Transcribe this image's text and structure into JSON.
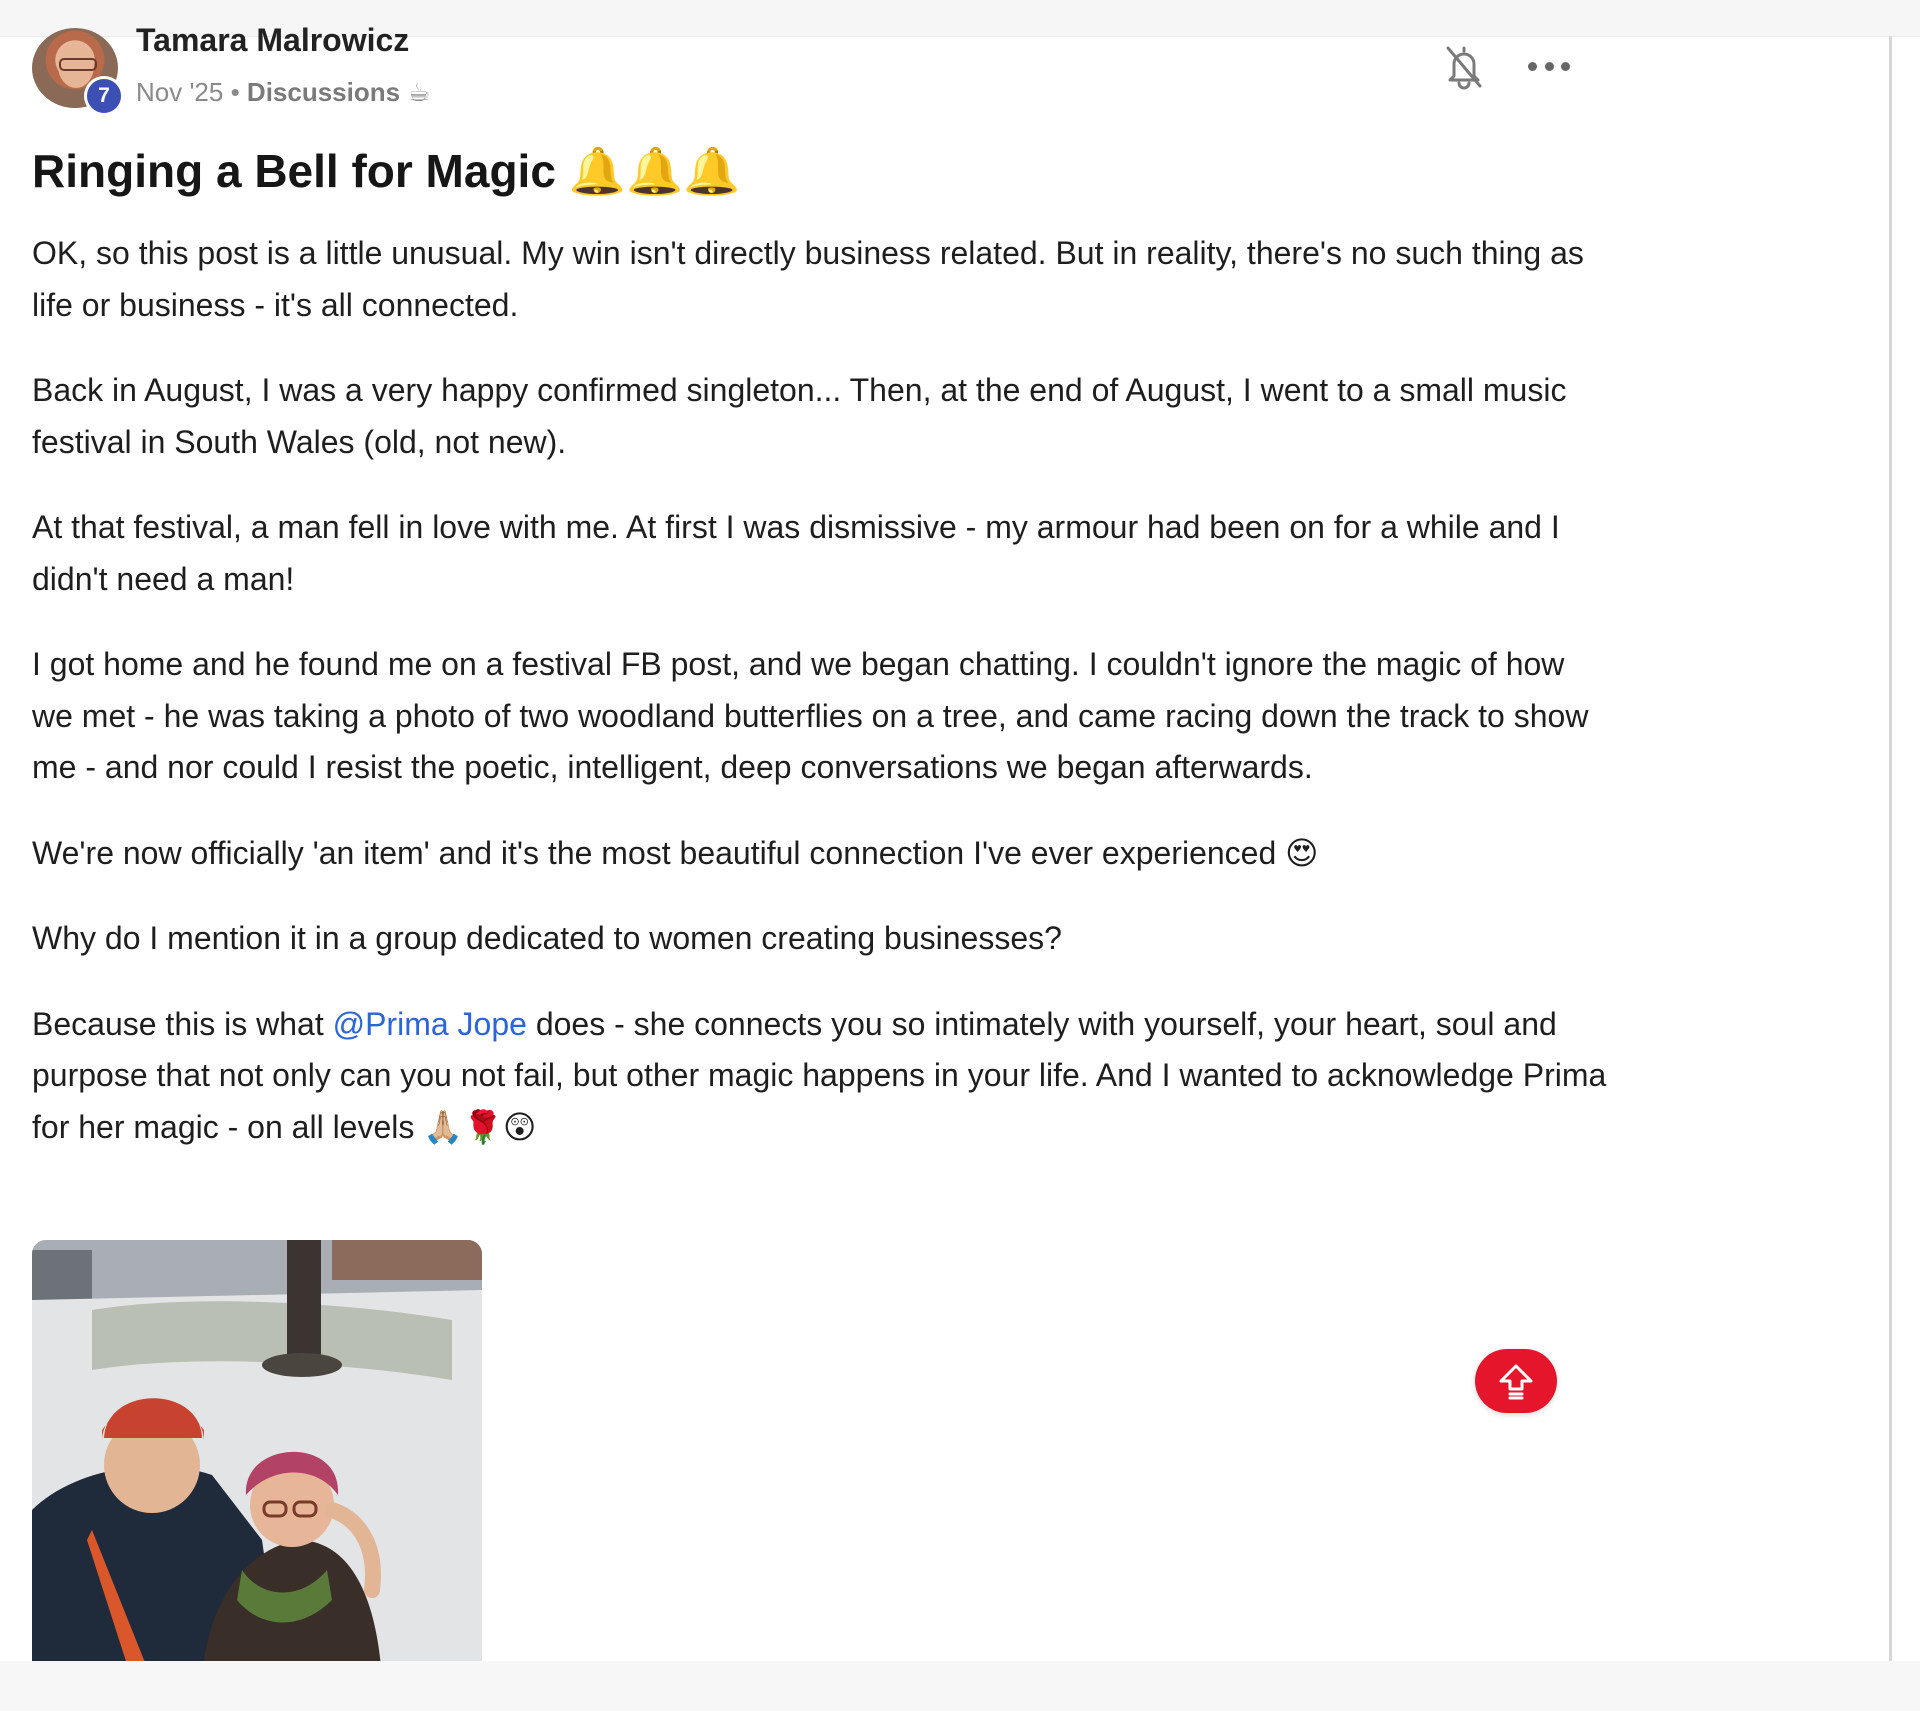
{
  "post": {
    "author": "Tamara Malrowicz",
    "level_badge": "7",
    "date": "Nov '25",
    "separator": "•",
    "category": "Discussions",
    "category_emoji": "☕",
    "title": "Ringing a Bell for Magic 🔔🔔🔔",
    "paragraphs": [
      "OK, so this post is a little unusual. My win isn't directly business related. But in reality, there's no such thing as life or business - it's all connected.",
      "Back in August, I was a very happy confirmed singleton... Then, at the end of August, I went to a small music festival in South Wales (old, not new).",
      "At that festival, a man fell in love with me. At first I was dismissive - my armour had been on for a while and I didn't need a man!",
      "I got home and he found me on a festival FB post, and we began chatting. I couldn't ignore the magic of how we met - he was taking a photo of two woodland butterflies on a tree, and came racing down the track to show me - and nor could I resist the poetic, intelligent, deep conversations we began afterwards.",
      "We're now officially 'an item' and it's the most beautiful connection I've ever experienced 😍",
      "Why do I mention it in a group dedicated to women creating businesses?"
    ],
    "last_paragraph": {
      "before": "Because this is what ",
      "mention": "@Prima Jope",
      "after": " does - she connects you so intimately with yourself, your heart, soul and purpose that not only can you not fail, but other magic happens in your life. And I wanted to acknowledge Prima for her magic - on all levels 🙏🏼🌹😲"
    }
  },
  "icons": {
    "notification": "bell-off-icon",
    "more": "more-horizontal-icon",
    "back_to_top": "arrow-up-icon"
  },
  "colors": {
    "mention": "#2b65d9",
    "badge": "#3c4fb3",
    "back_to_top": "#e5162c"
  }
}
